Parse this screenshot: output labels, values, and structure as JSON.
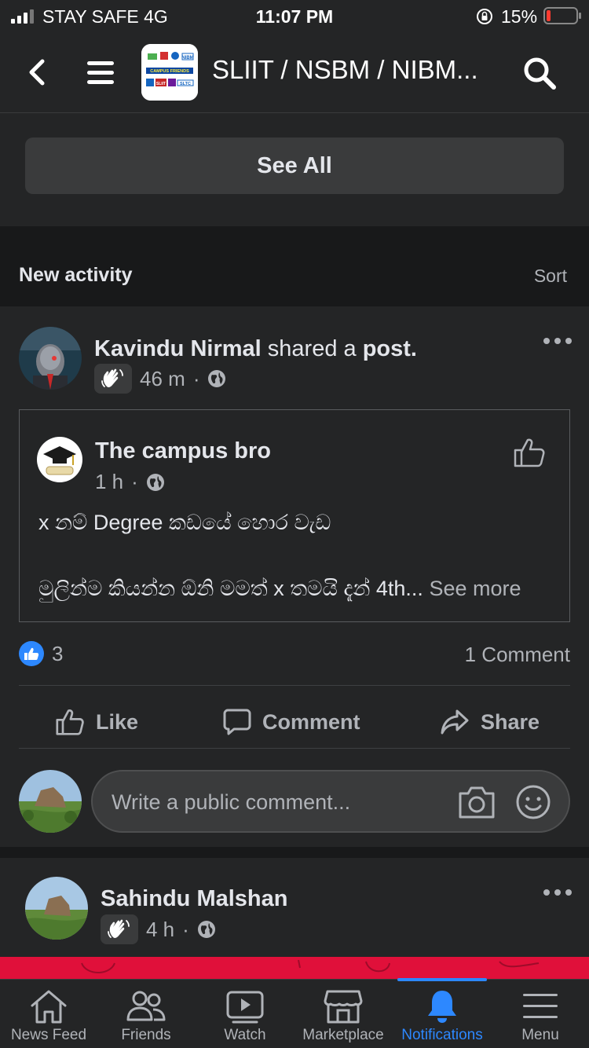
{
  "status_bar": {
    "carrier": "STAY SAFE  4G",
    "time": "11:07 PM",
    "battery_percent": "15%",
    "battery_level": 0.15
  },
  "header": {
    "back_icon": "chevron-left-icon",
    "menu_icon": "hamburger-icon",
    "group_logo_text": "CAMPUS FRIENDS",
    "group_logo_tags": [
      "NIBM",
      "SLIIT",
      "SLTC"
    ],
    "title": "SLIIT / NSBM / NIBM...",
    "search_icon": "search-icon"
  },
  "see_all_label": "See All",
  "activity": {
    "heading": "New activity",
    "sort_label": "Sort"
  },
  "post": {
    "author": "Kavindu Nirmal",
    "action_text": " shared a ",
    "object_text": "post.",
    "time": "46 m",
    "separator": "·",
    "shared": {
      "page_name": "The campus bro",
      "time": "1 h",
      "line1": "x නම් Degree කඩයේ හොර වැඩ",
      "line2": "මුලින්ම කියන්න ඕනි මමත් x තමයි දැන් 4th...",
      "see_more": " See more"
    },
    "reaction_count": "3",
    "comments_count": "1 Comment",
    "actions": {
      "like": "Like",
      "comment": "Comment",
      "share": "Share"
    },
    "comment_placeholder": "Write a public comment..."
  },
  "post2": {
    "author": "Sahindu Malshan",
    "time": "4 h",
    "separator": "·"
  },
  "tabs": [
    {
      "label": "News Feed",
      "icon": "home-icon"
    },
    {
      "label": "Friends",
      "icon": "friends-icon"
    },
    {
      "label": "Watch",
      "icon": "watch-icon"
    },
    {
      "label": "Marketplace",
      "icon": "marketplace-icon"
    },
    {
      "label": "Notifications",
      "icon": "bell-icon",
      "active": true
    },
    {
      "label": "Menu",
      "icon": "menu-icon"
    }
  ],
  "colors": {
    "background": "#242526",
    "accent": "#2d88ff",
    "text": "#e4e6eb",
    "muted": "#b0b3b8"
  }
}
